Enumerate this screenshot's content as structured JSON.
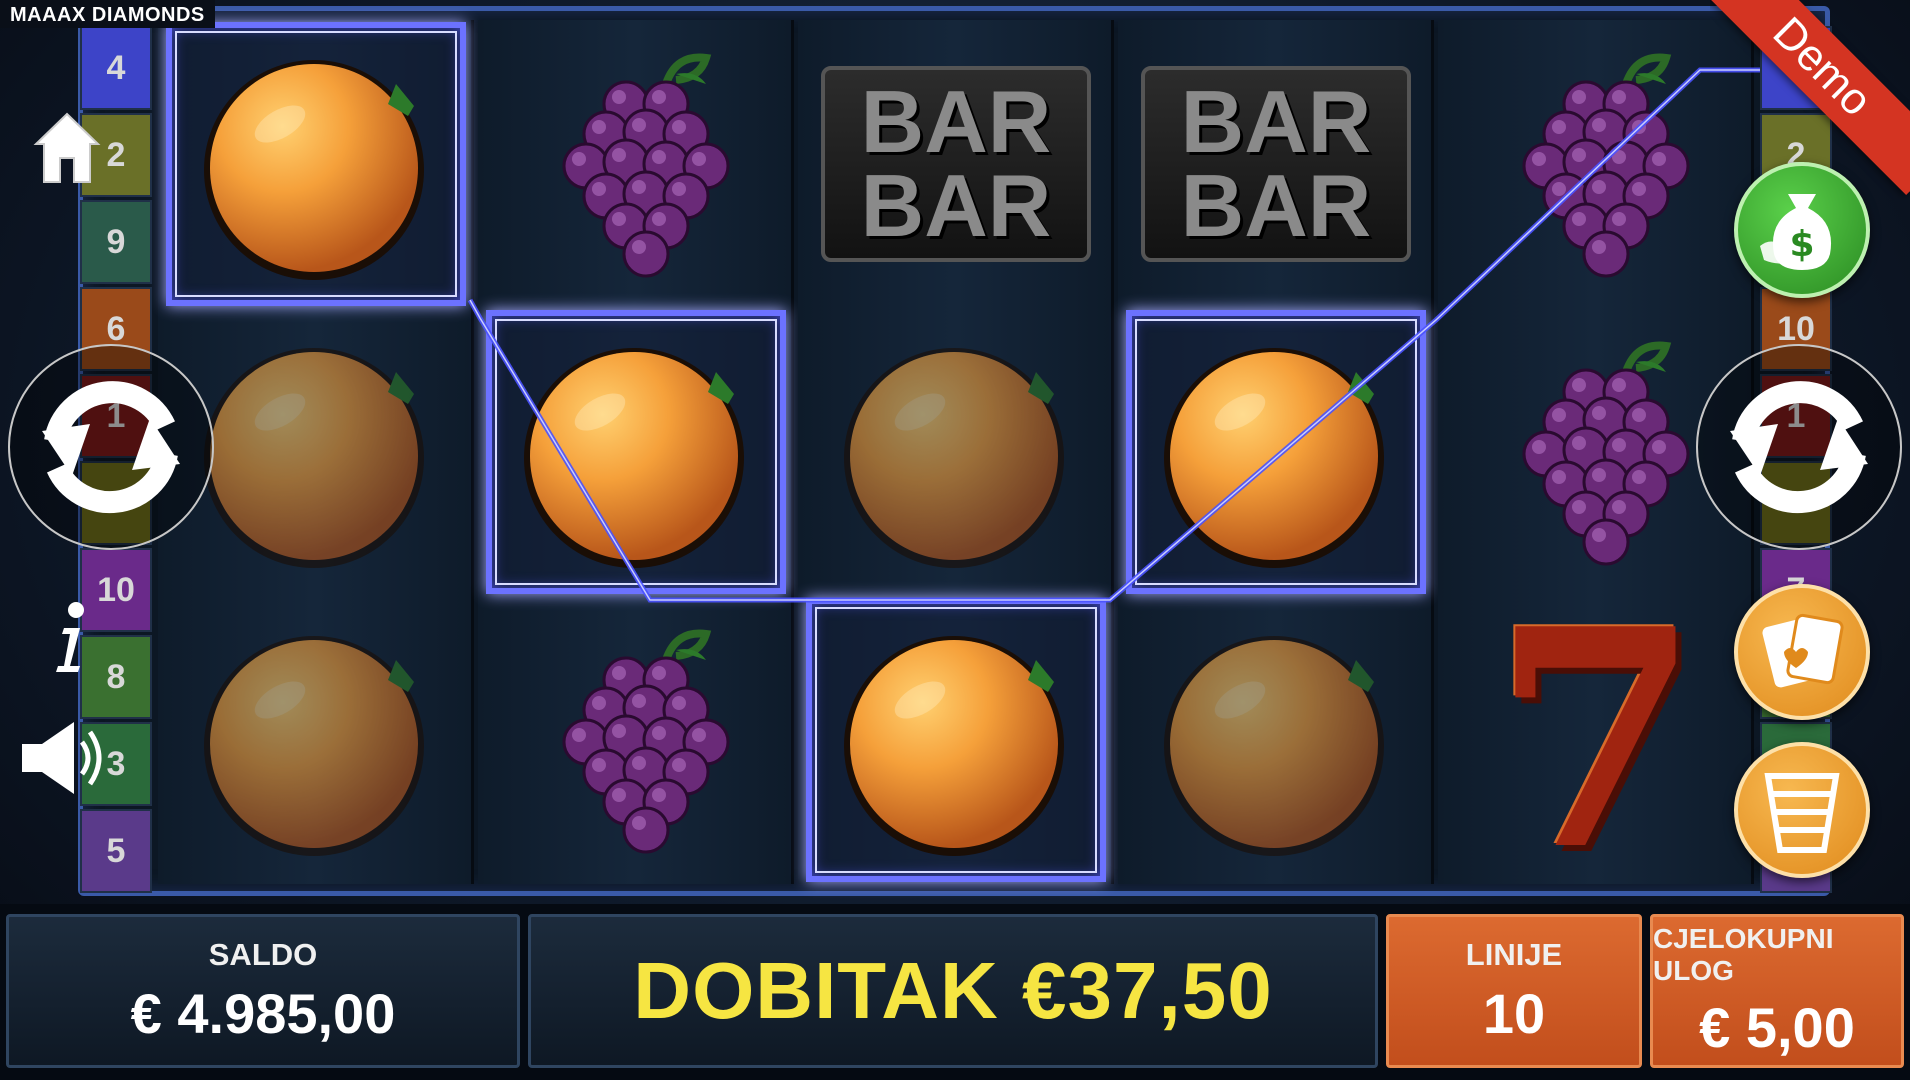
{
  "game_title": "MAAAX DIAMONDS",
  "demo_label": "Demo",
  "left_line_numbers": [
    "4",
    "2",
    "9",
    "6",
    "1",
    "",
    "10",
    "8",
    "3",
    "5"
  ],
  "right_line_numbers": [
    "4",
    "2",
    "",
    "10",
    "1",
    "",
    "7",
    "",
    "",
    ""
  ],
  "reels": [
    [
      {
        "symbol": "orange",
        "win": true
      },
      {
        "symbol": "orange",
        "win": false
      },
      {
        "symbol": "orange",
        "win": false
      }
    ],
    [
      {
        "symbol": "grapes",
        "win": false
      },
      {
        "symbol": "orange",
        "win": true
      },
      {
        "symbol": "grapes",
        "win": false
      }
    ],
    [
      {
        "symbol": "bar",
        "win": false
      },
      {
        "symbol": "orange",
        "win": false
      },
      {
        "symbol": "orange",
        "win": true
      }
    ],
    [
      {
        "symbol": "bar",
        "win": false
      },
      {
        "symbol": "orange",
        "win": true
      },
      {
        "symbol": "orange",
        "win": false
      }
    ],
    [
      {
        "symbol": "grapes",
        "win": false
      },
      {
        "symbol": "grapes",
        "win": false
      },
      {
        "symbol": "seven",
        "win": false
      }
    ]
  ],
  "bar_text": [
    "BAR",
    "BAR"
  ],
  "seven_text": "7",
  "bottom": {
    "balance_label": "SALDO",
    "balance_value": "€ 4.985,00",
    "win_text": "DOBITAK €37,50",
    "lines_label": "LINIJE",
    "lines_value": "10",
    "total_bet_label": "CJELOKUPNI ULOG",
    "total_bet_value": "€ 5,00"
  },
  "icons": {
    "home": "home-icon",
    "info": "info-icon",
    "sound": "speaker-icon",
    "autoplay_left": "refresh-icon",
    "autoplay_right": "refresh-icon",
    "cashout": "money-bag-icon",
    "gamble": "cards-icon",
    "ladder": "ladder-icon"
  },
  "colors": {
    "win_text": "#f6e542",
    "orange_panel": "#d45e26",
    "win_frame": "#6c72ff",
    "demo_ribbon": "#d43422"
  }
}
